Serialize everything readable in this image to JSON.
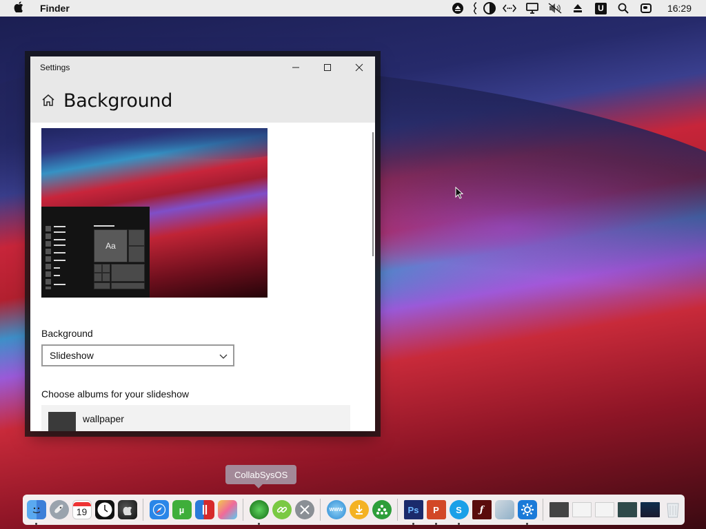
{
  "menubar": {
    "app_name": "Finder",
    "clock": "16:29",
    "u_label": "U"
  },
  "window": {
    "title": "Settings",
    "page_title": "Background",
    "preview_tile_text": "Aa",
    "background_label": "Background",
    "background_value": "Slideshow",
    "albums_label": "Choose albums for your slideshow",
    "album_item": "wallpaper"
  },
  "dock": {
    "tooltip": "CollabSysOS",
    "calendar_day": "19",
    "ps_label": "Ps",
    "ppt_label": "P",
    "skype_label": "S",
    "www_label": "WWW"
  },
  "colors": {
    "menubar_bg": "#ececec",
    "window_header_bg": "#e8e8e8",
    "dock_bg": "#fafafa",
    "tooltip_bg": "#a596a5",
    "accent_blue": "#1e88e5"
  }
}
